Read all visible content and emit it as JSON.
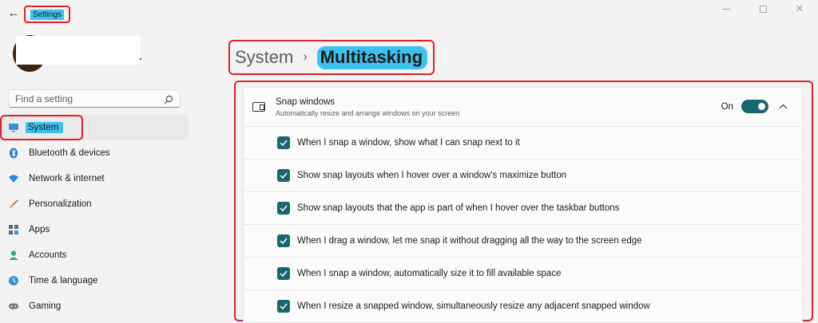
{
  "window": {
    "title": "Settings",
    "controls": [
      "minimize",
      "maximize",
      "close"
    ]
  },
  "search": {
    "placeholder": "Find a setting"
  },
  "sidebar": {
    "items": [
      {
        "label": "System",
        "icon": "monitor-icon",
        "active": true
      },
      {
        "label": "Bluetooth & devices",
        "icon": "bluetooth-icon"
      },
      {
        "label": "Network & internet",
        "icon": "wifi-icon"
      },
      {
        "label": "Personalization",
        "icon": "brush-icon"
      },
      {
        "label": "Apps",
        "icon": "apps-icon"
      },
      {
        "label": "Accounts",
        "icon": "person-icon"
      },
      {
        "label": "Time & language",
        "icon": "globe-clock-icon"
      },
      {
        "label": "Gaming",
        "icon": "gamepad-icon"
      }
    ]
  },
  "breadcrumb": {
    "parent": "System",
    "separator": "›",
    "current": "Multitasking"
  },
  "snap": {
    "title": "Snap windows",
    "subtitle": "Automatically resize and arrange windows on your screen",
    "toggle_label": "On",
    "toggle_on": true,
    "options": [
      {
        "label": "When I snap a window, show what I can snap next to it",
        "checked": true
      },
      {
        "label": "Show snap layouts when I hover over a window's maximize button",
        "checked": true
      },
      {
        "label": "Show snap layouts that the app is part of when I hover over the taskbar buttons",
        "checked": true
      },
      {
        "label": "When I drag a window, let me snap it without dragging all the way to the screen edge",
        "checked": true
      },
      {
        "label": "When I snap a window, automatically size it to fill available space",
        "checked": true
      },
      {
        "label": "When I resize a snapped window, simultaneously resize any adjacent snapped window",
        "checked": true
      }
    ]
  },
  "colors": {
    "accent": "#1a6670",
    "highlight": "#3ec1ee",
    "annotation": "#e0202d"
  }
}
